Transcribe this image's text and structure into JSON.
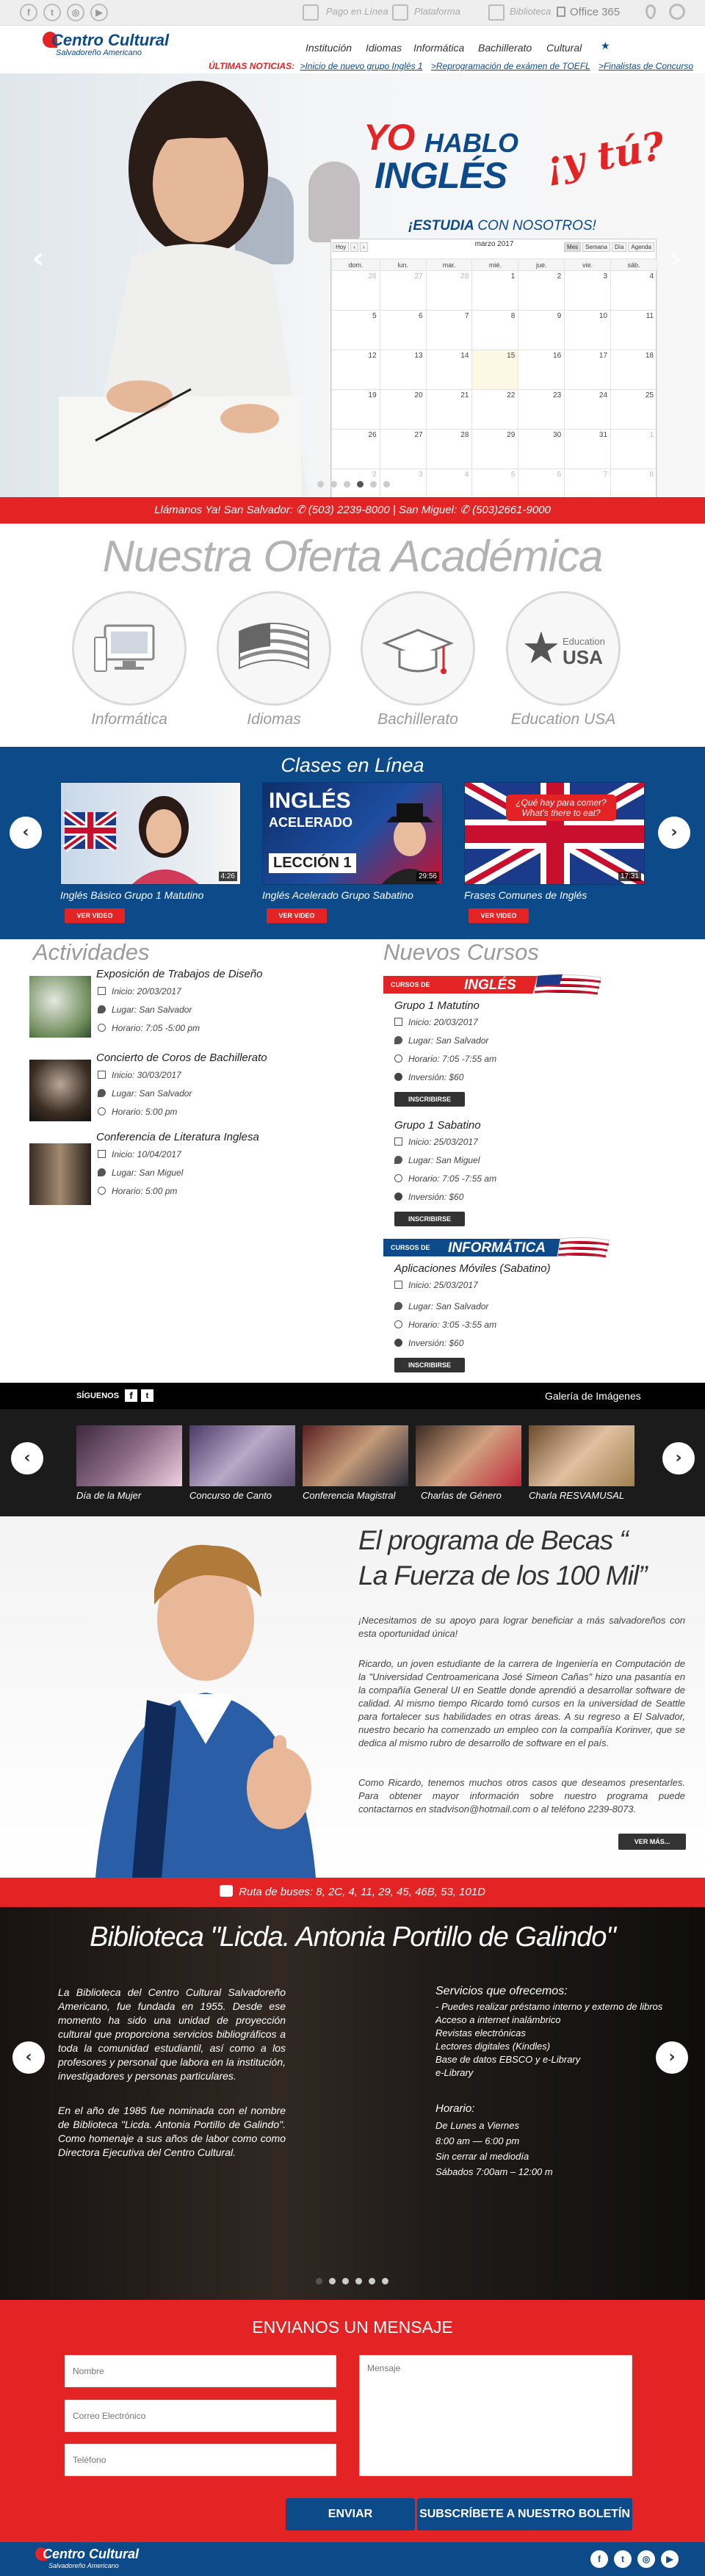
{
  "social_top": [
    "f",
    "t",
    "◎",
    "▶"
  ],
  "toplinks": {
    "pago": "Pago en Línea",
    "plataforma": "Plataforma",
    "biblioteca": "Biblioteca",
    "office": "Office 365"
  },
  "brand": {
    "name": "Centro Cultural",
    "sub": "Salvadoreño Americano"
  },
  "nav": [
    "Institución",
    "Idiomas",
    "Informática",
    "Bachillerato",
    "Cultural"
  ],
  "ticker": {
    "label": "ÚLTIMAS NOTICIAS:",
    "items": [
      ">Inicio de nuevo grupo Inglés 1",
      ">Reprogramación de exámen de TOEFL",
      ">Finalistas de Concurso"
    ]
  },
  "hero": {
    "yo": "YO",
    "hablo": "HABLO",
    "ingles": "INGLÉS",
    "ytu": "¡y tú?",
    "estudia": "¡ESTUDIA",
    "con": "CON NOSOTROS!"
  },
  "calendar": {
    "month": "marzo 2017",
    "buttons_left": [
      "Hoy",
      "‹",
      "›"
    ],
    "buttons_right": [
      "Mes",
      "Semana",
      "Día",
      "Agenda"
    ],
    "headers": [
      "dom.",
      "lun.",
      "mar.",
      "mié.",
      "jue.",
      "vie.",
      "sáb."
    ],
    "weeks": [
      [
        "26",
        "27",
        "28",
        "1",
        "2",
        "3",
        "4"
      ],
      [
        "5",
        "6",
        "7",
        "8",
        "9",
        "10",
        "11"
      ],
      [
        "12",
        "13",
        "14",
        "15",
        "16",
        "17",
        "18"
      ],
      [
        "19",
        "20",
        "21",
        "22",
        "23",
        "24",
        "25"
      ],
      [
        "26",
        "27",
        "28",
        "29",
        "30",
        "31",
        "1"
      ],
      [
        "2",
        "3",
        "4",
        "5",
        "6",
        "7",
        "8"
      ]
    ]
  },
  "callbar": {
    "prefix": "Llámanos Ya! San Salvador:",
    "ss": "(503) 2239-8000",
    "sep": "| San Miguel:",
    "sm": "(503)2661-9000"
  },
  "oferta": {
    "title": "Nuestra Oferta Académica",
    "items": [
      "Informática",
      "Idiomas",
      "Bachillerato",
      "Education USA"
    ],
    "edusa_small": "Education",
    "edusa_big": "USA"
  },
  "clases": {
    "title": "Clases en Línea",
    "videos": [
      {
        "title": "Inglés Básico Grupo 1 Matutino",
        "dur": "4:26"
      },
      {
        "title": "Inglés Acelerado Grupo Sabatino",
        "dur": "29:56",
        "l1": "INGLÉS",
        "l2": "ACELERADO",
        "l3": "LECCIÓN 1"
      },
      {
        "title": "Frases Comunes de Inglés",
        "dur": "17:31",
        "q1": "¿Qué hay para comer?",
        "q2": "What's there to eat?"
      }
    ],
    "btn": "VER VIDEO"
  },
  "actividades": {
    "title": "Actividades",
    "items": [
      {
        "title": "Exposición de Trabajos de Diseño",
        "inicio": "Inicio: 20/03/2017",
        "lugar": "Lugar: San Salvador",
        "horario": "Horario: 7:05 -5:00 pm"
      },
      {
        "title": "Concierto de Coros de Bachillerato",
        "inicio": "Inicio: 30/03/2017",
        "lugar": "Lugar: San Salvador",
        "horario": "Horario: 5:00 pm"
      },
      {
        "title": "Conferencia de Literatura Inglesa",
        "inicio": "Inicio: 10/04/2017",
        "lugar": "Lugar: San Miguel",
        "horario": "Horario: 5:00 pm"
      }
    ]
  },
  "cursos": {
    "title": "Nuevos Cursos",
    "banner1_small": "CURSOS DE",
    "banner1_big": "INGLÉS",
    "banner2_small": "CURSOS DE",
    "banner2_big": "INFORMÁTICA",
    "items": [
      {
        "title": "Grupo 1 Matutino",
        "inicio": "Inicio: 20/03/2017",
        "lugar": "Lugar: San Salvador",
        "horario": "Horario: 7:05 -7:55 am",
        "inversion": "Inversión: $60"
      },
      {
        "title": "Grupo 1 Sabatino",
        "inicio": "Inicio: 25/03/2017",
        "lugar": "Lugar: San Miguel",
        "horario": "Horario: 7:05 -7:55 am",
        "inversion": "Inversión: $60"
      },
      {
        "title": "Aplicaciones Móviles (Sabatino)",
        "inicio": "Inicio: 25/03/2017",
        "lugar": "Lugar: San Salvador",
        "horario": "Horario: 3:05 -3:55 am",
        "inversion": "Inversión: $60"
      }
    ],
    "btn": "INSCRIBIRSE"
  },
  "galeria": {
    "siguenos": "SÍGUENOS",
    "title": "Galería de Imágenes",
    "items": [
      "Día de la Mujer",
      "Concurso de Canto",
      "Conferencia Magistral",
      "Charlas de Género",
      "Charla RESVAMUSAL"
    ]
  },
  "becas": {
    "title1": "El programa de Becas “",
    "title2": "La Fuerza de los 100 Mil”",
    "p1": "¡Necesitamos de su apoyo para lograr beneficiar a más salvadoreños con esta oportunidad única!",
    "p2": "Ricardo, un joven estudiante de la carrera de Ingeniería en Computación de la \"Universidad Centroamericana José Simeon Cañas\" hizo una pasantía en la compañía General UI en Seattle donde aprendió a desarrollar software de calidad. Al mismo tiempo Ricardo tomó cursos en la universidad de Seattle para fortalecer sus habilidades en otras áreas. A su regreso a El Salvador, nuestro becario ha comenzado un empleo con la compañía Korinver, que se dedica al mismo rubro de desarrollo de software en el país.",
    "p3": "Como Ricardo, tenemos muchos otros casos que deseamos presentarles. Para obtener mayor información sobre nuestro programa puede contactarnos en stadvison@hotmail.com o al teléfono 2239-8073.",
    "btn": "VER MÁS..."
  },
  "ruta": {
    "label": "Ruta de buses:",
    "value": "8, 2C, 4, 11, 29, 45, 46B, 53, 101D"
  },
  "biblio": {
    "title": "Biblioteca \"Licda. Antonia Portillo de Galindo\"",
    "p1": "La Biblioteca del Centro Cultural Salvadoreño Americano, fue fundada en 1955. Desde ese momento ha sido una unidad de proyección cultural que proporciona servicios bibliográficos a toda la comunidad estudiantil, así como a los profesores y personal que labora en la institución, investigadores y personas particulares.",
    "p2": "En el año de 1985 fue nominada con el nombre de Biblioteca \"Licda. Antonia Portillo de Galindo\". Como homenaje a sus años de labor como como Directora Ejecutiva del Centro Cultural.",
    "services_title": "Servicios que ofrecemos:",
    "services": [
      "- Puedes realizar préstamo interno y externo de libros",
      "Acceso a internet inalámbrico",
      "Revistas electrónicas",
      "Lectores digitales (Kindles)",
      "Base de datos EBSCO y e-Library",
      "e-Library"
    ],
    "horario_title": "Horario:",
    "horario": [
      "De Lunes a Viernes",
      "8:00 am — 6:00 pm",
      "Sin cerrar al mediodía",
      "Sábados 7:00am – 12:00 m"
    ]
  },
  "form": {
    "title": "ENVIANOS UN MENSAJE",
    "nombre": "Nombre",
    "correo": "Correo Electrónico",
    "telefono": "Teléfono",
    "mensaje": "Mensaje",
    "enviar": "ENVIAR",
    "suscribir": "SUBSCRÍBETE A NUESTRO BOLETÍN"
  },
  "footer": {
    "name": "Centro Cultural",
    "sub": "Salvadoreño Americano",
    "social": [
      "f",
      "t",
      "◎",
      "▶"
    ]
  },
  "colors": {
    "red": "#e42325",
    "blue": "#0c4a8a"
  }
}
